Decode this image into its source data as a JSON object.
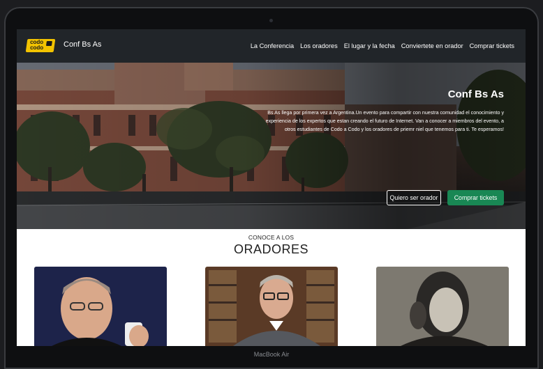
{
  "navbar": {
    "logo_text": "codo a codo",
    "brand": "Conf Bs As",
    "links": [
      "La Conferencia",
      "Los oradores",
      "El lugar y la fecha",
      "Conviertete en orador",
      "Comprar tickets"
    ]
  },
  "hero": {
    "title": "Conf Bs As",
    "description": "Bs As llega por primera vez a Argentina.Un evento para compartir con nuestra comunidad el conocimiento y experiencia de los expertos que estan creando el futuro de Internet. Van a conocer a miembros del evento, a otros estudiantes de Codo a Codo y los oradores de priemr niel que tenemos para ti. Te esperamos!",
    "btn_speaker": "Quiero ser orador",
    "btn_tickets": "Comprar tickets"
  },
  "speakers": {
    "kicker": "CONOCE A LOS",
    "title": "ORADORES"
  },
  "device_label": "MacBook Air",
  "colors": {
    "navbar": "#212529",
    "accent_green": "#198754",
    "logo_yellow": "#f3c300"
  }
}
